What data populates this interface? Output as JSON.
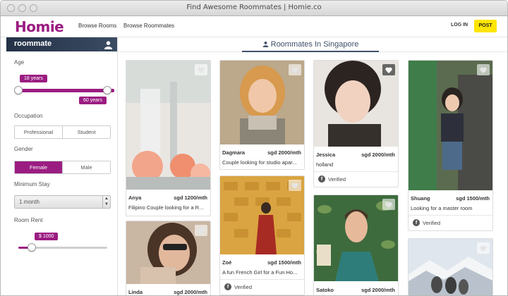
{
  "window": {
    "title": "Find Awesome Roommates | Homie.co"
  },
  "nav": {
    "logo": "Homie",
    "browse_rooms": "Browse Rooms",
    "browse_roommates": "Browse Roommates",
    "login": "LOG IN",
    "post": "POST"
  },
  "sidebar": {
    "header": "roommate",
    "age_label": "Age",
    "age_min": "18 years",
    "age_max": "60 years",
    "occupation_label": "Occupation",
    "occupation_options": [
      "Professional",
      "Student"
    ],
    "gender_label": "Gender",
    "gender_options": [
      "Female",
      "Male"
    ],
    "gender_selected": "Female",
    "min_stay_label": "Minimum Stay",
    "min_stay_value": "1 month",
    "rent_label": "Room Rent",
    "rent_value": "$ 1000",
    "rent_fraction": 0.15
  },
  "main": {
    "heading": "Roommates In Singapore"
  },
  "cards": [
    {
      "name": "Anya",
      "price": "sgd 1200/mth",
      "desc": "Filipino Couple looking for a R...",
      "verified": "",
      "favorited": false
    },
    {
      "name": "Dagmara",
      "price": "sgd 2000/mth",
      "desc": "Couple looking for studio apar...",
      "verified": "",
      "favorited": false
    },
    {
      "name": "Jessica",
      "price": "sgd 2000/mth",
      "desc": "holland",
      "verified": "Verified",
      "favorited": true
    },
    {
      "name": "Shuang",
      "price": "sgd 1500/mth",
      "desc": "Looking for a master room",
      "verified": "Verified",
      "favorited": false
    },
    {
      "name": "Linda",
      "price": "sgd 2000/mth",
      "desc": "",
      "verified": "",
      "favorited": false
    },
    {
      "name": "Zoé",
      "price": "sgd 1500/mth",
      "desc": "A fun French Girl for a Fun Ho...",
      "verified": "Verified",
      "favorited": false
    },
    {
      "name": "Satoko",
      "price": "sgd 2000/mth",
      "desc": "",
      "verified": "",
      "favorited": false
    },
    {
      "name": "",
      "price": "",
      "desc": "",
      "verified": "",
      "favorited": false
    }
  ],
  "colors": {
    "brand": "#9b1d82",
    "post_button": "#ffe500",
    "header_dark": "#3f5068"
  }
}
